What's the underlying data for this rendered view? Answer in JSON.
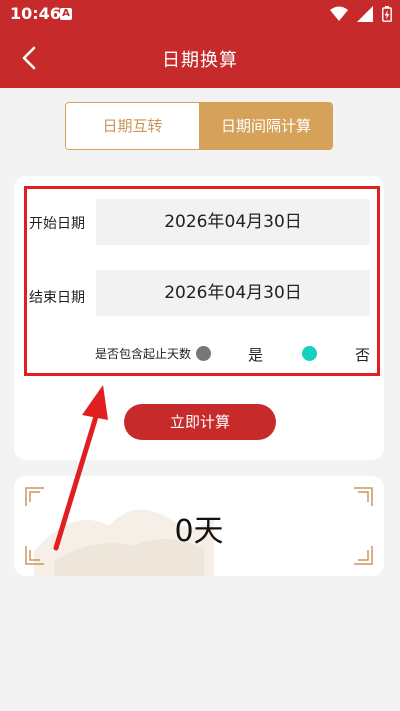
{
  "status": {
    "time": "10:46",
    "notif_icon": "A"
  },
  "appbar": {
    "title": "日期换算",
    "back_icon": "chevron-left-icon"
  },
  "tabs": [
    {
      "label": "日期互转",
      "active": false
    },
    {
      "label": "日期间隔计算",
      "active": true
    }
  ],
  "form": {
    "start_label": "开始日期",
    "start_value": "2026年04月30日",
    "end_label": "结束日期",
    "end_value": "2026年04月30日",
    "include_label": "是否包含起止天数",
    "yes_label": "是",
    "no_label": "否",
    "selected": "否"
  },
  "action": {
    "calc_label": "立即计算"
  },
  "result": {
    "text": "0天"
  },
  "colors": {
    "primary": "#c72a2a",
    "gold": "#d6a25a",
    "teal": "#19cfc0",
    "annotation": "#e02020"
  }
}
